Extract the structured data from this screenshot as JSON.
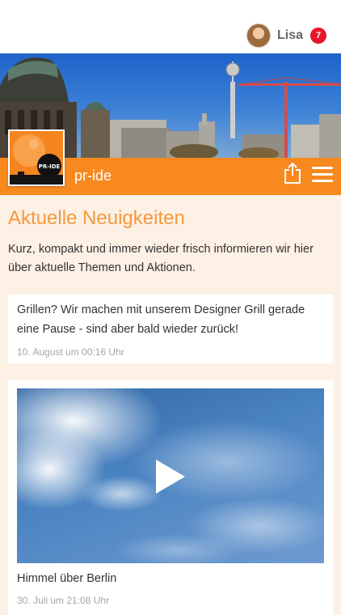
{
  "user": {
    "name": "Lisa",
    "notification_count": "7"
  },
  "header": {
    "brand": "pr-ide",
    "logo_text": "PR-IDE"
  },
  "page": {
    "title": "Aktuelle Neuigkeiten",
    "intro": "Kurz, kompakt und immer wieder frisch informieren wir hier über aktuelle Themen und Aktionen."
  },
  "posts": [
    {
      "text": "Grillen? Wir machen mit unserem Designer Grill gerade eine Pause - sind aber bald wieder zurück!",
      "date": "10. August um 00:16 Uhr"
    },
    {
      "caption": "Himmel über Berlin",
      "date": "30. Juli um 21:08 Uhr"
    }
  ],
  "icons": {
    "share": "share-icon",
    "menu": "hamburger-menu-icon",
    "play": "play-icon"
  },
  "colors": {
    "accent": "#f7891e",
    "title": "#f39a3d",
    "badge": "#e8152a",
    "background": "#fdf0e5"
  }
}
